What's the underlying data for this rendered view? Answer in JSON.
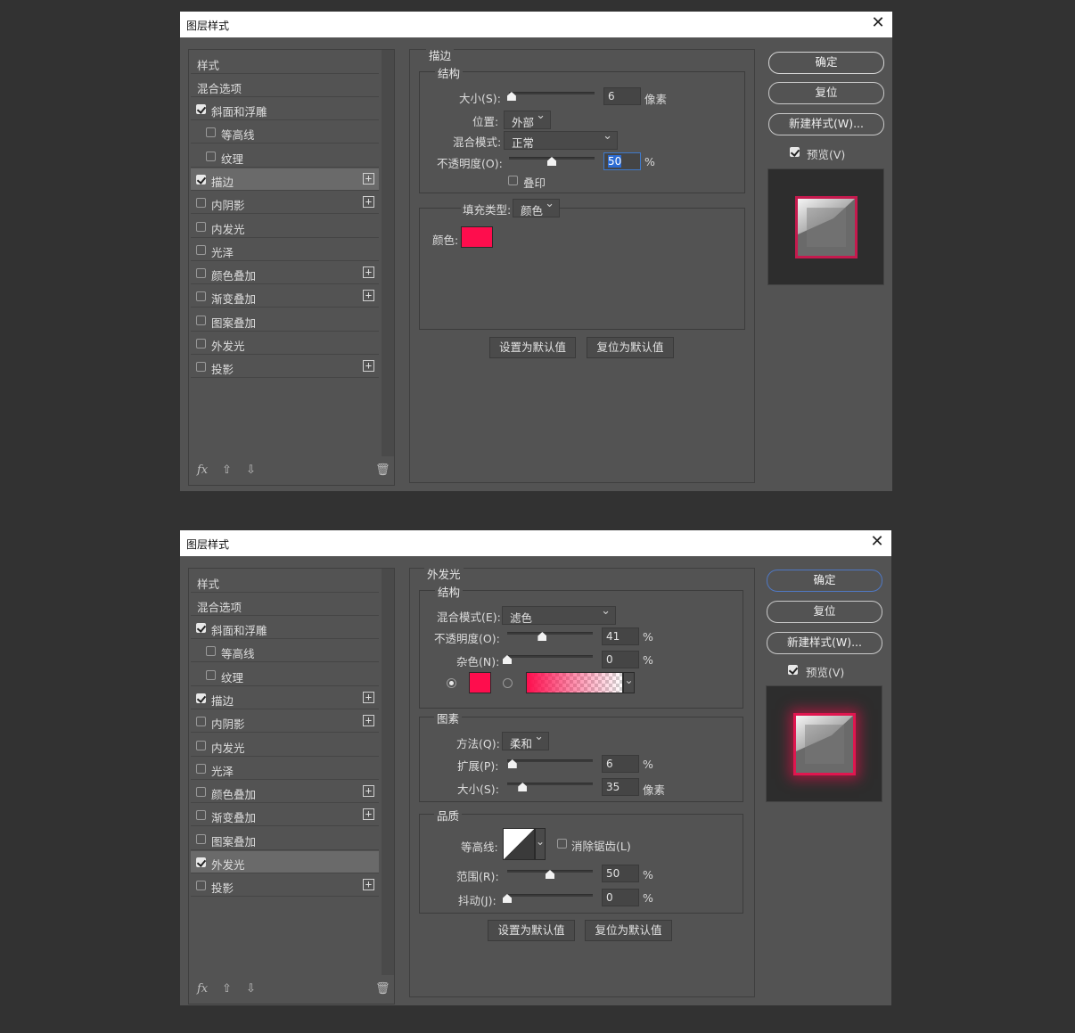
{
  "dialog1": {
    "title": "图层样式",
    "styles_header": "样式",
    "blend_options": "混合选项",
    "items": [
      {
        "label": "斜面和浮雕",
        "checked": true
      },
      {
        "label": "等高线",
        "checked": false
      },
      {
        "label": "纹理",
        "checked": false
      },
      {
        "label": "描边",
        "checked": true
      },
      {
        "label": "内阴影",
        "checked": false
      },
      {
        "label": "内发光",
        "checked": false
      },
      {
        "label": "光泽",
        "checked": false
      },
      {
        "label": "颜色叠加",
        "checked": false
      },
      {
        "label": "渐变叠加",
        "checked": false
      },
      {
        "label": "图案叠加",
        "checked": false
      },
      {
        "label": "外发光",
        "checked": false
      },
      {
        "label": "投影",
        "checked": false
      }
    ],
    "panel_title": "描边",
    "structure_title": "结构",
    "size_label": "大小(S):",
    "size_value": "6",
    "size_unit": "像素",
    "position_label": "位置:",
    "position_value": "外部",
    "blend_label": "混合模式:",
    "blend_value": "正常",
    "opacity_label": "不透明度(O):",
    "opacity_value": "50",
    "percent": "%",
    "overprint_label": "叠印",
    "fill_type_label": "填充类型:",
    "fill_type_value": "颜色",
    "color_label": "颜色:",
    "set_default": "设置为默认值",
    "reset_default": "复位为默认值",
    "ok": "确定",
    "reset": "复位",
    "new_style": "新建样式(W)...",
    "preview": "预览(V)",
    "fx": "fx",
    "stroke_color": "#fe0d4d",
    "size_slider_percent": 3,
    "opacity_slider_percent": 50
  },
  "dialog2": {
    "title": "图层样式",
    "styles_header": "样式",
    "blend_options": "混合选项",
    "items": [
      {
        "label": "斜面和浮雕",
        "checked": true
      },
      {
        "label": "等高线",
        "checked": false
      },
      {
        "label": "纹理",
        "checked": false
      },
      {
        "label": "描边",
        "checked": true
      },
      {
        "label": "内阴影",
        "checked": false
      },
      {
        "label": "内发光",
        "checked": false
      },
      {
        "label": "光泽",
        "checked": false
      },
      {
        "label": "颜色叠加",
        "checked": false
      },
      {
        "label": "渐变叠加",
        "checked": false
      },
      {
        "label": "图案叠加",
        "checked": false
      },
      {
        "label": "外发光",
        "checked": true
      },
      {
        "label": "投影",
        "checked": false
      }
    ],
    "panel_title": "外发光",
    "structure_title": "结构",
    "blend_label": "混合模式(E):",
    "blend_value": "滤色",
    "opacity_label": "不透明度(O):",
    "opacity_value": "41",
    "noise_label": "杂色(N):",
    "noise_value": "0",
    "percent": "%",
    "elements_title": "图素",
    "method_label": "方法(Q):",
    "method_value": "柔和",
    "spread_label": "扩展(P):",
    "spread_value": "6",
    "size_label": "大小(S):",
    "size_value": "35",
    "size_unit": "像素",
    "quality_title": "品质",
    "contour_label": "等高线:",
    "antialias_label": "消除锯齿(L)",
    "range_label": "范围(R):",
    "range_value": "50",
    "jitter_label": "抖动(J):",
    "jitter_value": "0",
    "set_default": "设置为默认值",
    "reset_default": "复位为默认值",
    "ok": "确定",
    "reset": "复位",
    "new_style": "新建样式(W)...",
    "preview": "预览(V)",
    "fx": "fx",
    "glow_color": "#fe0d4d",
    "opacity_slider_percent": 41,
    "noise_slider_percent": 0,
    "spread_slider_percent": 6,
    "size_slider_percent": 18,
    "range_slider_percent": 50,
    "jitter_slider_percent": 0
  }
}
